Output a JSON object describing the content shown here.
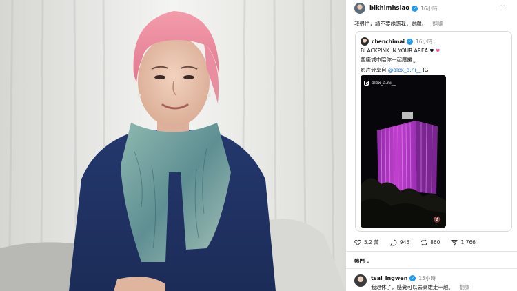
{
  "post": {
    "username": "bikhimhsiao",
    "time": "16小時",
    "more_icon": "more-dots-icon",
    "text": "我很忙，請不要誘惑我，謝謝。",
    "translate_label": "翻譯"
  },
  "quote": {
    "username": "chenchimai",
    "time": "16小時",
    "line1": "BLACKPINK IN YOUR AREA",
    "line2": "整座城市陪你一起應援. ̫.",
    "line3_prefix": "影片分享自",
    "line3_mention": "@alex_a.ni__",
    "line3_suffix": "IG",
    "video": {
      "handle": "alex_a.ni__"
    }
  },
  "actions": {
    "likes": "5.2 萬",
    "comments": "945",
    "reposts": "860",
    "shares": "1,766"
  },
  "hot_label": "熱門",
  "reply": {
    "username": "tsai_ingwen",
    "time": "15小時",
    "text": "我退休了，感覺可以去高雄走一趟。",
    "translate_label": "翻譯"
  },
  "colors": {
    "verified": "#1d9bf0",
    "mention": "#1d6fd8",
    "building_glow": "#c23fd0"
  }
}
